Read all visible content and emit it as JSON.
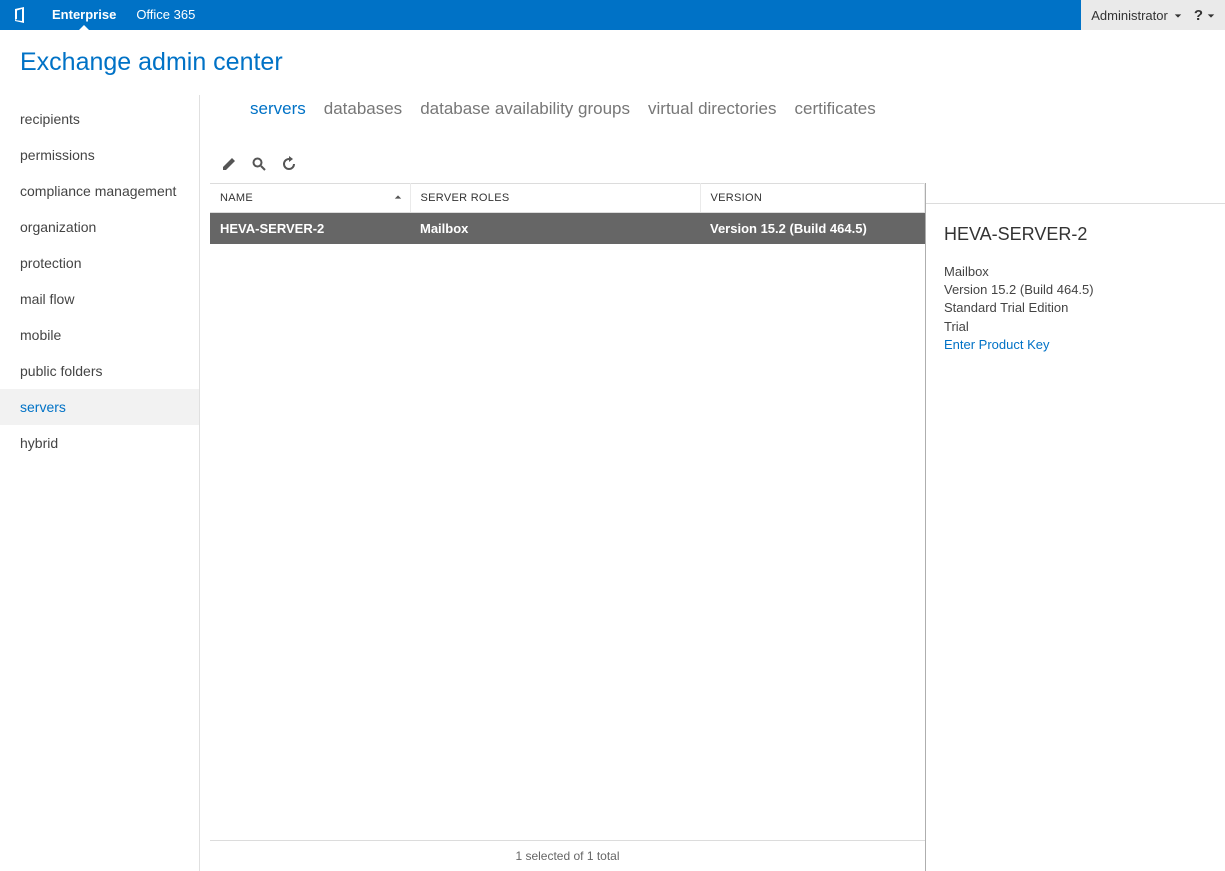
{
  "topbar": {
    "tabs": [
      {
        "label": "Enterprise",
        "active": true
      },
      {
        "label": "Office 365",
        "active": false
      }
    ],
    "user_label": "Administrator",
    "help_label": "?"
  },
  "title": "Exchange admin center",
  "sidebar": {
    "items": [
      {
        "label": "recipients"
      },
      {
        "label": "permissions"
      },
      {
        "label": "compliance management"
      },
      {
        "label": "organization"
      },
      {
        "label": "protection"
      },
      {
        "label": "mail flow"
      },
      {
        "label": "mobile"
      },
      {
        "label": "public folders"
      },
      {
        "label": "servers",
        "selected": true
      },
      {
        "label": "hybrid"
      }
    ]
  },
  "tabs": [
    {
      "label": "servers",
      "active": true
    },
    {
      "label": "databases"
    },
    {
      "label": "database availability groups"
    },
    {
      "label": "virtual directories"
    },
    {
      "label": "certificates"
    }
  ],
  "toolbar": {
    "edit_tooltip": "Edit",
    "search_tooltip": "Search",
    "refresh_tooltip": "Refresh"
  },
  "grid": {
    "columns": [
      {
        "label": "NAME",
        "sorted": "asc"
      },
      {
        "label": "SERVER ROLES"
      },
      {
        "label": "VERSION"
      }
    ],
    "rows": [
      {
        "name": "HEVA-SERVER-2",
        "roles": "Mailbox",
        "version": "Version 15.2 (Build 464.5)",
        "selected": true
      }
    ],
    "footer": "1 selected of 1 total"
  },
  "details": {
    "title": "HEVA-SERVER-2",
    "lines": [
      "Mailbox",
      "Version 15.2 (Build 464.5)",
      "Standard Trial Edition",
      "Trial"
    ],
    "link_label": "Enter Product Key"
  }
}
